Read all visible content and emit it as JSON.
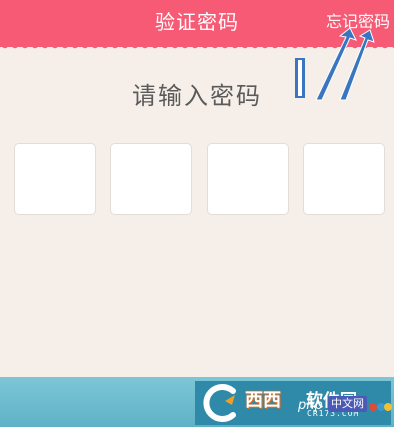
{
  "header": {
    "title": "验证密码",
    "forgot_link": "忘记密码"
  },
  "main": {
    "prompt": "请输入密码",
    "pin_boxes": [
      "",
      "",
      "",
      ""
    ]
  },
  "footer": {
    "brand_text": "西西",
    "brand_text2": "软件园",
    "brand_url": "CR173.COM",
    "watermark_php": "php",
    "watermark_cn": "中文网"
  },
  "colors": {
    "header_bg": "#f65a74",
    "page_bg": "#f6efe9",
    "annotation_blue": "#3a76c0"
  },
  "icons": [
    "annotation-arrow-icon",
    "cursor-marker-icon",
    "brand-logo-icon"
  ]
}
